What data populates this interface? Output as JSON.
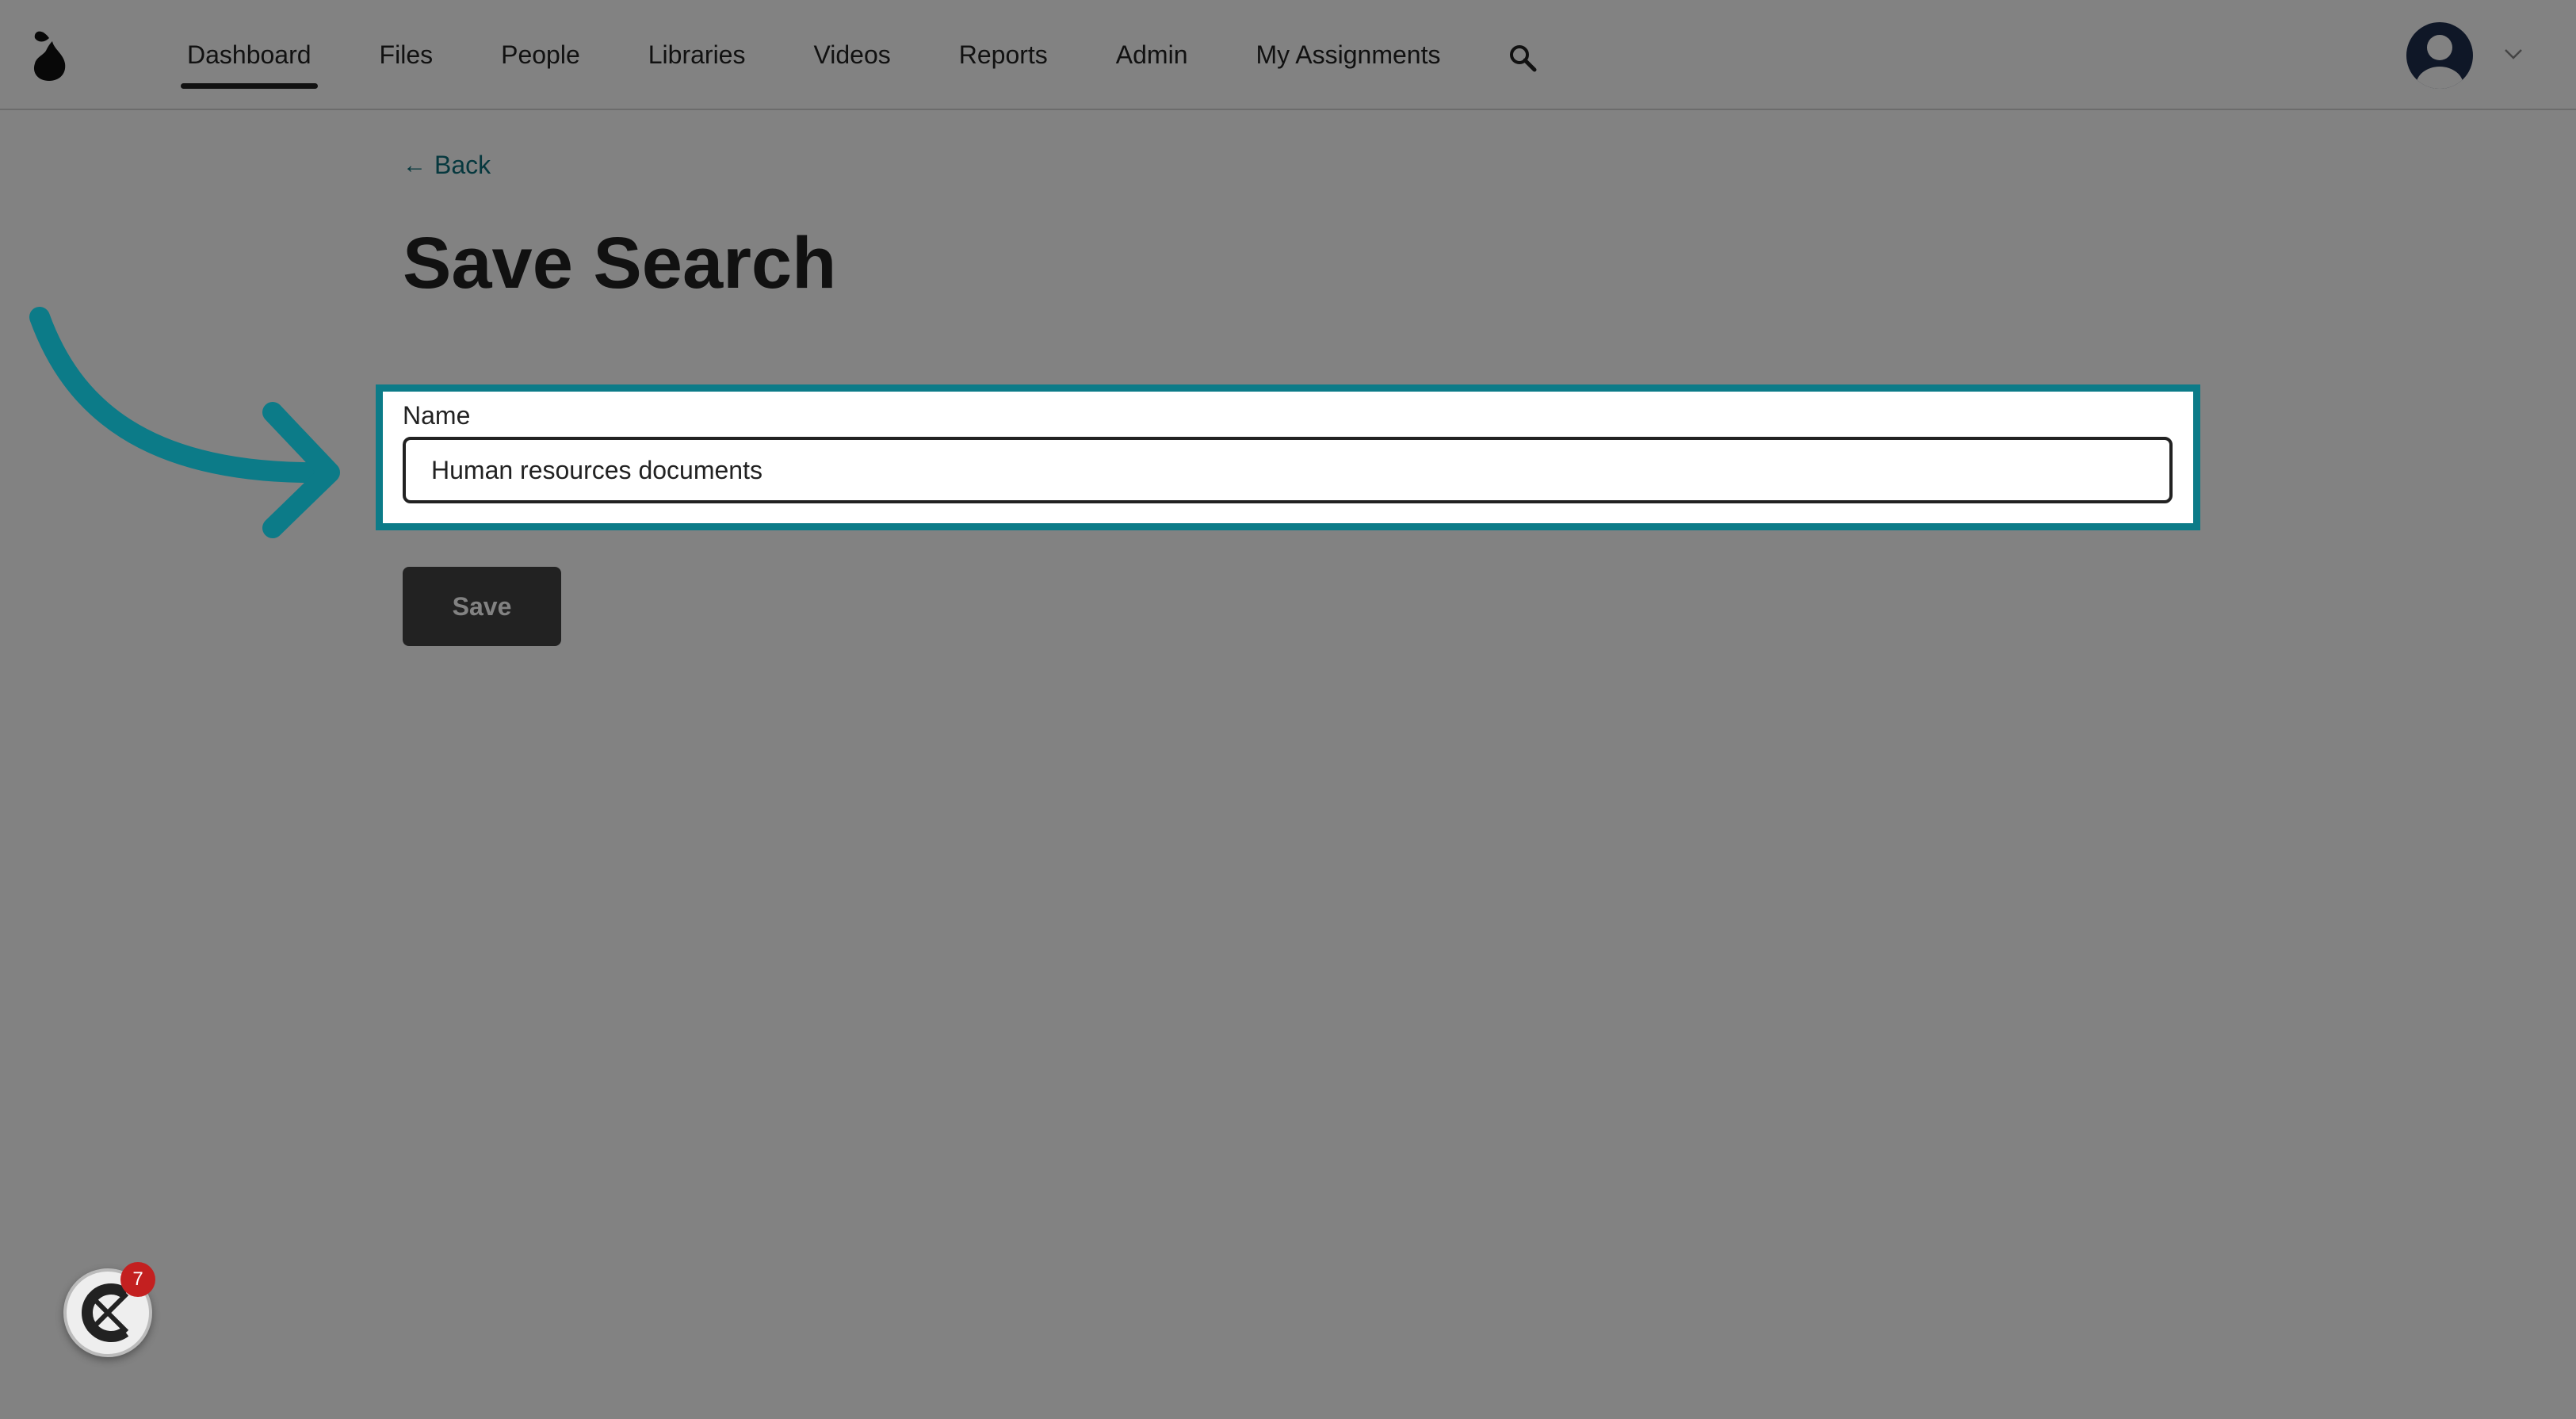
{
  "header": {
    "nav": [
      {
        "label": "Dashboard",
        "active": true
      },
      {
        "label": "Files",
        "active": false
      },
      {
        "label": "People",
        "active": false
      },
      {
        "label": "Libraries",
        "active": false
      },
      {
        "label": "Videos",
        "active": false
      },
      {
        "label": "Reports",
        "active": false
      },
      {
        "label": "Admin",
        "active": false
      },
      {
        "label": "My Assignments",
        "active": false
      }
    ],
    "icons": {
      "logo": "pear-logo-icon",
      "search": "search-icon",
      "avatar": "user-avatar-icon",
      "menu": "chevron-down-icon"
    }
  },
  "main": {
    "back_label": "Back",
    "title": "Save Search",
    "name_label": "Name",
    "name_value": "Human resources documents",
    "save_label": "Save"
  },
  "widget": {
    "badge_count": "7",
    "icon": "help-widget-icon"
  },
  "colors": {
    "accent": "#0c7b88",
    "link": "#0d6e7a",
    "text": "#222222",
    "button": "#444444",
    "badge": "#c32020"
  }
}
